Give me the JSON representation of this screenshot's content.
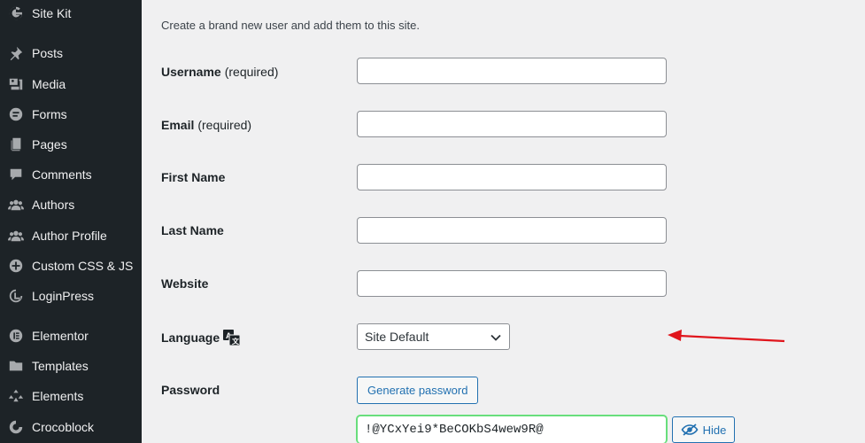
{
  "sidebar": {
    "items": [
      {
        "label": "Site Kit",
        "icon": "google-g-icon"
      },
      {
        "label": "Posts",
        "icon": "pin-icon"
      },
      {
        "label": "Media",
        "icon": "media-icon"
      },
      {
        "label": "Forms",
        "icon": "forms-icon"
      },
      {
        "label": "Pages",
        "icon": "pages-icon"
      },
      {
        "label": "Comments",
        "icon": "comment-icon"
      },
      {
        "label": "Authors",
        "icon": "users-icon"
      },
      {
        "label": "Author Profile",
        "icon": "users-icon"
      },
      {
        "label": "Custom CSS & JS",
        "icon": "plus-circle-icon"
      },
      {
        "label": "LoginPress",
        "icon": "loginpress-icon"
      },
      {
        "label": "Elementor",
        "icon": "elementor-icon"
      },
      {
        "label": "Templates",
        "icon": "folder-icon"
      },
      {
        "label": "Elements",
        "icon": "elements-icon"
      },
      {
        "label": "Crocoblock",
        "icon": "crocoblock-icon"
      }
    ]
  },
  "form": {
    "intro": "Create a brand new user and add them to this site.",
    "username_label": "Username",
    "username_req": "(required)",
    "username_value": "",
    "email_label": "Email",
    "email_req": "(required)",
    "email_value": "",
    "first_name_label": "First Name",
    "first_name_value": "",
    "last_name_label": "Last Name",
    "last_name_value": "",
    "website_label": "Website",
    "website_value": "",
    "language_label": "Language",
    "language_selected": "Site Default",
    "password_label": "Password",
    "generate_button": "Generate password",
    "password_value": "!@YCxYei9*BeCOKbS4wew9R@",
    "hide_button": "Hide"
  },
  "colors": {
    "sidebar_bg": "#1d2327",
    "accent": "#2271b1",
    "annotation_arrow": "#e0151c",
    "password_strong_border": "#68de7c"
  }
}
